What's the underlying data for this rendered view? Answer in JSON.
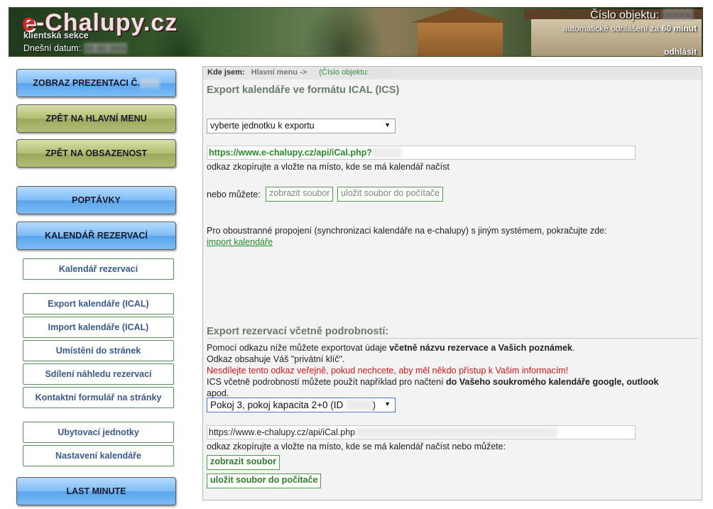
{
  "header": {
    "logo_e": "e",
    "logo_rest": "-Chalupy.cz",
    "sekce": "klientská sekce",
    "datum_label": "Dnešní datum:",
    "cislo_label": "Číslo objektu:",
    "auto_text": "automatické odhlášení za",
    "auto_time": "60 minut",
    "logout": "odhlásit"
  },
  "sidebar": {
    "buttons": [
      {
        "label": "ZOBRAZ PREZENTACI Č.",
        "style": "blue"
      },
      {
        "label": "ZPĚT NA HLAVNÍ MENU",
        "style": "olive"
      },
      {
        "label": "ZPĚT NA OBSAZENOST",
        "style": "olive"
      },
      {
        "label": "POPTÁVKY",
        "style": "blue"
      },
      {
        "label": "KALENDÁŘ REZERVACÍ",
        "style": "blue"
      },
      {
        "label": "LAST MINUTE",
        "style": "blue"
      }
    ],
    "subitems": [
      "Kalendář rezervací",
      "Export kalendáře (ICAL)",
      "Import kalendáře (ICAL)",
      "Umístění do stránek",
      "Sdílení náhledu rezervací",
      "Kontaktní formulář na stránky",
      "Ubytovací jednotky",
      "Nastavení kalendáře"
    ]
  },
  "breadcrumb": {
    "label": "Kde jsem:",
    "path": "Hlavní menu ->",
    "object": "(Číslo objektu:"
  },
  "section1": {
    "title": "Export kalendáře ve formátu ICAL (ICS)",
    "select_value": "vyberte jednotku k exportu",
    "url": "https://www.e-chalupy.cz/api/iCal.php?",
    "copy_hint": "odkaz zkopírujte a vložte na místo, kde se má kalendář načíst",
    "or_text": "nebo můžete:",
    "btn_show": "zobrazit soubor",
    "btn_save": "uložit soubor do počítače",
    "sync_text": "Pro oboustranné propojení (synchronizaci kalendáře na e-chalupy) s jiným systémem, pokračujte zde:",
    "import_link": "import kalendáře"
  },
  "section2": {
    "title": "Export rezervací včetně podrobností:",
    "line1_a": "Pomocí odkazu níže můžete exportovat údaje ",
    "line1_b": "včetně názvu rezervace a Vašich poznámek",
    "line1_c": ".",
    "line2": "Odkaz obsahuje Váš \"privátní klíč\".",
    "warning": "Nesdílejte tento odkaz veřejně, pokud nechcete, aby měl někdo přístup k Vašim informacím!",
    "line4_a": "ICS včetně podrobností můžete použít například pro načtení ",
    "line4_b": "do Vašeho soukromého kalendáře google, outlook",
    "line4_c": "apod.",
    "select_value": "Pokoj 3, pokoj kapacita 2+0 (ID",
    "select_tail": ")",
    "url": "https://www.e-chalupy.cz/api/iCal.php",
    "copy_hint": "odkaz zkopírujte a vložte na místo, kde se má kalendář načíst nebo můžete:",
    "btn_show": "zobrazit soubor",
    "btn_save": "uložit soubor do počítače"
  }
}
